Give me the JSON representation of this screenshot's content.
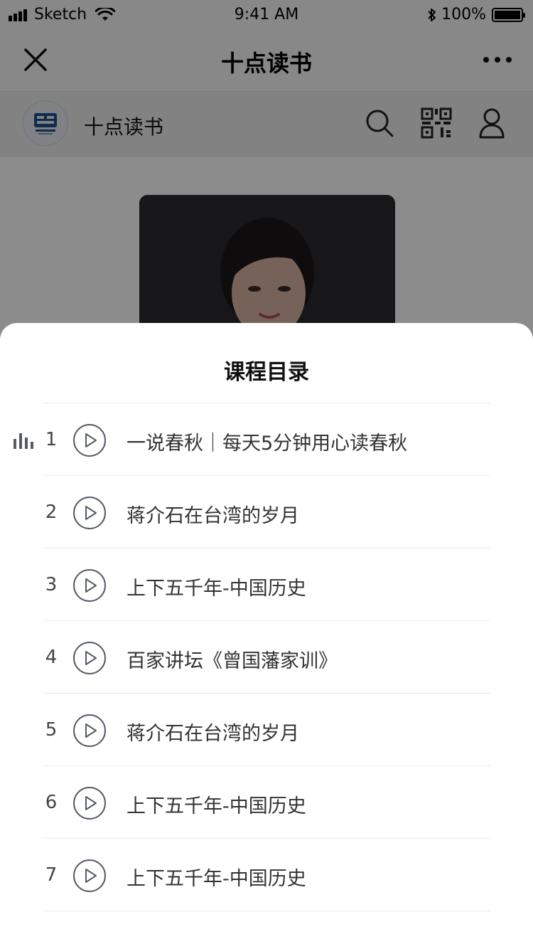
{
  "status_bar": {
    "carrier": "Sketch",
    "time": "9:41 AM",
    "battery": "100%"
  },
  "nav": {
    "title": "十点读书"
  },
  "account": {
    "name": "十点读书"
  },
  "sheet": {
    "title": "课程目录",
    "items": [
      {
        "num": "1",
        "title": "一说春秋｜每天5分钟用心读春秋",
        "playing": true
      },
      {
        "num": "2",
        "title": "蒋介石在台湾的岁月",
        "playing": false
      },
      {
        "num": "3",
        "title": "上下五千年-中国历史",
        "playing": false
      },
      {
        "num": "4",
        "title": "百家讲坛《曾国藩家训》",
        "playing": false
      },
      {
        "num": "5",
        "title": "蒋介石在台湾的岁月",
        "playing": false
      },
      {
        "num": "6",
        "title": "上下五千年-中国历史",
        "playing": false
      },
      {
        "num": "7",
        "title": "上下五千年-中国历史",
        "playing": false
      }
    ]
  },
  "colors": {
    "overlay": "#000000",
    "sheet_bg": "#ffffff",
    "icon_stroke": "#555a66"
  }
}
